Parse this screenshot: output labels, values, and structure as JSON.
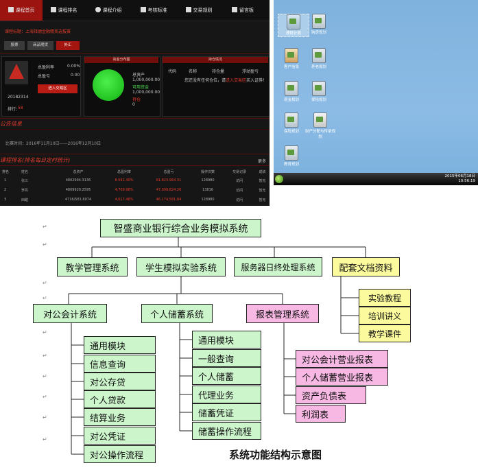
{
  "app": {
    "nav": [
      {
        "label": "课程首页",
        "icon": "flag-icon",
        "active": true
      },
      {
        "label": "课程排名",
        "icon": "list-icon"
      },
      {
        "label": "课程介绍",
        "icon": "pie-icon"
      },
      {
        "label": "考核标准",
        "icon": "star-icon"
      },
      {
        "label": "交易规则",
        "icon": "document-icon"
      },
      {
        "label": "留言板",
        "icon": "edit-icon"
      }
    ],
    "course_label": "课程标题：上海拜德金融精英选拔赛",
    "tabs": [
      "股票",
      "商品期货",
      "外汇"
    ],
    "account": {
      "id": "20182314",
      "rank_label": "排行：",
      "rank_value": "58",
      "total_return_label": "总盈利率",
      "total_return_value": "0.00%",
      "total_profit_label": "总盈亏",
      "total_profit_value": "0.00",
      "enter_button": "进入交易区"
    },
    "fund_panel": {
      "title": "资金分布图",
      "lines": [
        "总资产",
        "1,000,000.00",
        "可用资金",
        "1,000,000.00",
        "持仓",
        "0"
      ]
    },
    "holdings": {
      "title": "持仓情况",
      "columns": [
        "代码",
        "名称",
        "持仓量",
        "浮动盈亏"
      ],
      "empty_prefix": "您还没有任何仓位，请",
      "empty_link": "进入交易区",
      "empty_suffix": "买入证券！"
    },
    "notice": {
      "title": "公告信息",
      "text": "比赛时间：2016年11月10日——2016年12月10日"
    },
    "ranking": {
      "title": "课程排名(排名每日定时统计)",
      "more": "更多",
      "columns": [
        "排名",
        "姓名",
        "总资产",
        "总盈利率",
        "总盈亏",
        "操作次数",
        "交易记录",
        "成绩"
      ],
      "rows": [
        [
          "1",
          "张三",
          "4802994.3136",
          "8.591.40%",
          "81,823,964.31",
          "128980",
          "访问",
          "暂无"
        ],
        [
          "2",
          "罗丹",
          "4809920.2595",
          "4,709.98%",
          "47,099,824.26",
          "13816",
          "访问",
          "暂无"
        ],
        [
          "3",
          "田甜",
          "4716/581.8074",
          "4,617.48%",
          "46,174,581.84",
          "128980",
          "访问",
          "暂无"
        ]
      ]
    }
  },
  "desktop": {
    "icons": [
      {
        "label": "理财计算",
        "selected": true
      },
      {
        "label": "购房规划"
      },
      {
        "label": "客户信息"
      },
      {
        "label": "养老规划"
      },
      {
        "label": "现金规划"
      },
      {
        "label": "保险规划"
      },
      {
        "label": "保险规划"
      },
      {
        "label": "财产分配与传承规划"
      },
      {
        "label": "教育规划"
      }
    ],
    "date": "2015年06月18日",
    "time": "10:56:19"
  },
  "diagram": {
    "root": "智盛商业银行综合业务模拟系统",
    "level1": [
      "教学管理系统",
      "学生模拟实验系统",
      "服务器日终处理系统",
      "配套文档资料"
    ],
    "docs": [
      "实验教程",
      "培训讲义",
      "教学课件"
    ],
    "level2": [
      "对公会计系统",
      "个人储蓄系统",
      "报表管理系统"
    ],
    "corp_items": [
      "通用模块",
      "信息查询",
      "对公存贷",
      "个人贷款",
      "结算业务",
      "对公凭证",
      "对公操作流程"
    ],
    "savings_items": [
      "通用模块",
      "一般查询",
      "个人储蓄",
      "代理业务",
      "储蓄凭证",
      "储蓄操作流程"
    ],
    "report_items": [
      "对公会计营业报表",
      "个人储蓄营业报表",
      "资产负债表",
      "利润表"
    ],
    "caption": "系统功能结构示意图",
    "colors": {
      "green": "#ccf5cc",
      "pink": "#f7b8e4",
      "yellow": "#fbfb9e"
    }
  }
}
